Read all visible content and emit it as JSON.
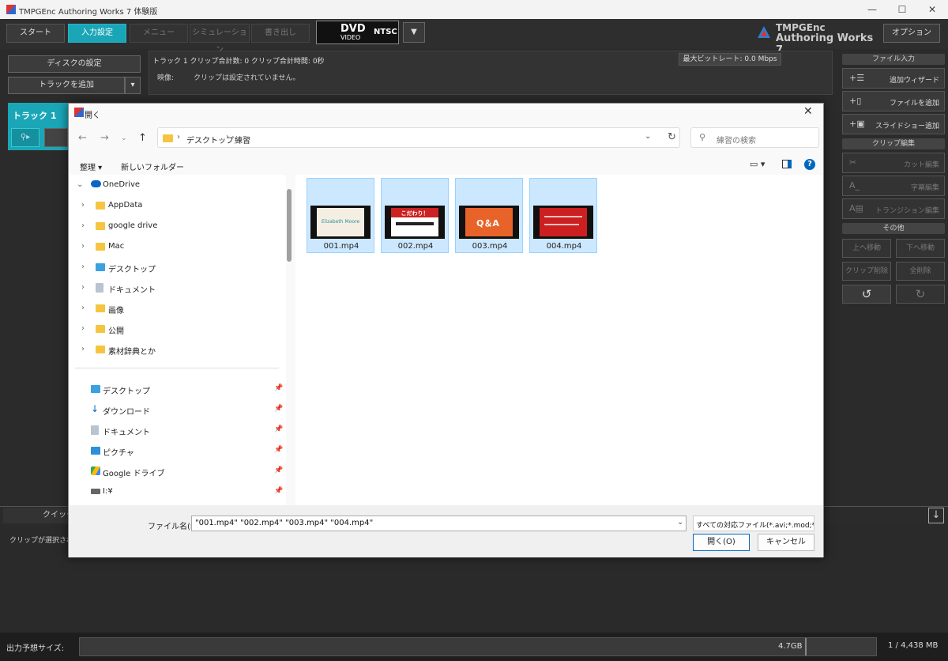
{
  "window": {
    "title": "TMPGEnc Authoring Works 7 体験版"
  },
  "toolbar": {
    "tabs": [
      "スタート",
      "入力設定",
      "メニュー",
      "シミュレーション",
      "書き出し"
    ],
    "active_tab": "入力設定",
    "dvd_label": "DVD",
    "video_label": "VIDEO",
    "ntsc_label": "NTSC",
    "brand_line1": "TMPGEnc",
    "brand_line2": "Authoring Works 7",
    "option_label": "オプション"
  },
  "left_panel": {
    "disc_settings": "ディスクの設定",
    "add_track": "トラックを追加",
    "track_title": "トラック 1"
  },
  "track_info": {
    "summary": "トラック 1   クリップ合計数:  0    クリップ合計時間:  0秒",
    "max_bitrate": "最大ビットレート: 0.0 Mbps",
    "video_label": "映像:",
    "video_value": "クリップは設定されていません。"
  },
  "right_panel": {
    "section_file_input": "ファイル入力",
    "add_wizard": "追加ウィザード",
    "add_file": "ファイルを追加",
    "add_slideshow": "スライドショー追加",
    "section_clip_edit": "クリップ編集",
    "cut_edit": "カット編集",
    "subtitle_edit": "字幕編集",
    "transition_edit": "トランジション編集",
    "section_other": "その他",
    "move_up": "上へ移動",
    "move_down": "下へ移動",
    "delete_clip": "クリップ削除",
    "delete_all": "全削除"
  },
  "bottom": {
    "quick_tab": "クイックプロ",
    "no_clip_msg": "クリップが選択されて"
  },
  "status": {
    "label": "出力予想サイズ:",
    "capacity": "4.7GB",
    "count": "1 / 4,438 MB"
  },
  "dialog": {
    "title": "開く",
    "breadcrumb": [
      "デスクトップ",
      "練習"
    ],
    "search_placeholder": "練習の検索",
    "organize": "整理 ▾",
    "new_folder": "新しいフォルダー",
    "tree": [
      {
        "label": "OneDrive",
        "expanded": true
      },
      {
        "label": "AppData"
      },
      {
        "label": "google drive"
      },
      {
        "label": "Mac"
      },
      {
        "label": "デスクトップ"
      },
      {
        "label": "ドキュメント"
      },
      {
        "label": "画像"
      },
      {
        "label": "公開"
      },
      {
        "label": "素材辞典とか"
      }
    ],
    "quick_access": [
      "デスクトップ",
      "ダウンロード",
      "ドキュメント",
      "ピクチャ",
      "Google ドライブ",
      "I:¥"
    ],
    "files": [
      {
        "name": "001.mp4",
        "thumb_text": "Elizabeth Moore",
        "thumb_color": "#f4efe2"
      },
      {
        "name": "002.mp4",
        "thumb_text": "こだわり！",
        "thumb_color": "#ffffff"
      },
      {
        "name": "003.mp4",
        "thumb_text": "Q＆A",
        "thumb_color": "#e8632a"
      },
      {
        "name": "004.mp4",
        "thumb_text": "",
        "thumb_color": "#cc1f1f"
      }
    ],
    "filename_label": "ファイル名(N):",
    "filename_value": "\"001.mp4\" \"002.mp4\" \"003.mp4\" \"004.mp4\"",
    "filetype": "すべての対応ファイル(*.avi;*.mod;*",
    "open_button": "開く(O)",
    "cancel_button": "キャンセル"
  },
  "colors": {
    "accent": "#1aa6b7",
    "selection": "#cce8ff"
  }
}
